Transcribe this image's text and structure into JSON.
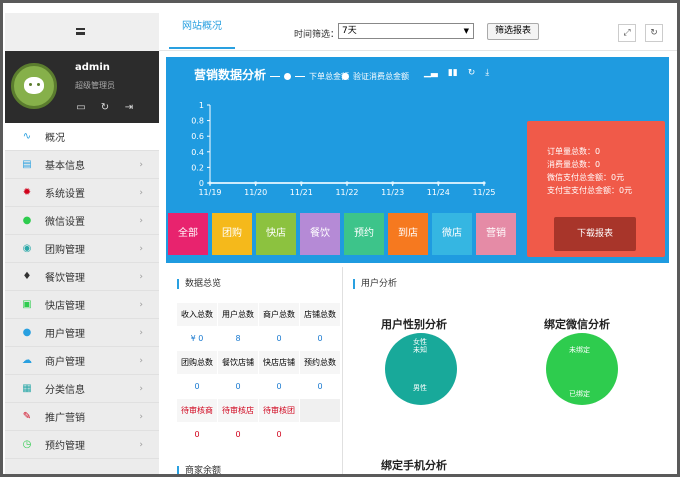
{
  "sidebar": {
    "user": {
      "name": "admin",
      "role": "超级管理员"
    },
    "items": [
      {
        "label": "概况",
        "icon": "line-chart-icon"
      },
      {
        "label": "基本信息",
        "icon": "card-icon"
      },
      {
        "label": "系统设置",
        "icon": "gear-icon"
      },
      {
        "label": "微信设置",
        "icon": "wechat-icon"
      },
      {
        "label": "团购管理",
        "icon": "globe-icon"
      },
      {
        "label": "餐饮管理",
        "icon": "pin-icon"
      },
      {
        "label": "快店管理",
        "icon": "basket-icon"
      },
      {
        "label": "用户管理",
        "icon": "user-icon"
      },
      {
        "label": "商户管理",
        "icon": "cloud-icon"
      },
      {
        "label": "分类信息",
        "icon": "list-icon"
      },
      {
        "label": "推广营销",
        "icon": "pen-icon"
      },
      {
        "label": "预约管理",
        "icon": "clock-icon"
      }
    ]
  },
  "topbar": {
    "tab": "网站概况",
    "filter_label": "时间筛选：",
    "filter_value": "7天",
    "filter_button": "筛选报表"
  },
  "dashboard": {
    "title": "营销数据分析",
    "legend": [
      "下单总金额",
      "验证消费总金额"
    ],
    "stats": [
      "订单量总数：0",
      "消费量总数：0",
      "微信支付总金额：0元",
      "支付宝支付总金额：0元"
    ],
    "download": "下载报表",
    "categories": [
      {
        "label": "全部",
        "color": "#e8236e"
      },
      {
        "label": "团购",
        "color": "#f5b91b"
      },
      {
        "label": "快店",
        "color": "#8cc23f"
      },
      {
        "label": "餐饮",
        "color": "#b58ad6"
      },
      {
        "label": "预约",
        "color": "#3dc48a"
      },
      {
        "label": "到店",
        "color": "#f6791f"
      },
      {
        "label": "微店",
        "color": "#35b6e2"
      },
      {
        "label": "营销",
        "color": "#e58ba6"
      }
    ]
  },
  "chart_data": {
    "type": "line",
    "x": [
      "11/19",
      "11/20",
      "11/21",
      "11/22",
      "11/23",
      "11/24",
      "11/25"
    ],
    "series": [
      {
        "name": "下单总金额",
        "values": [
          0,
          0,
          0,
          0,
          0,
          0,
          0
        ]
      },
      {
        "name": "验证消费总金额",
        "values": [
          0,
          0,
          0,
          0,
          0,
          0,
          0
        ]
      }
    ],
    "yticks": [
      "0",
      "0.2",
      "0.4",
      "0.6",
      "0.8",
      "1"
    ],
    "ylim": [
      0,
      1
    ],
    "grid": false
  },
  "overview": {
    "title": "数据总览",
    "cells": [
      {
        "t": "收入总数",
        "k": "h"
      },
      {
        "t": "用户总数",
        "k": "h"
      },
      {
        "t": "商户总数",
        "k": "h"
      },
      {
        "t": "店铺总数",
        "k": "h"
      },
      {
        "t": "¥ 0",
        "k": "v"
      },
      {
        "t": "8",
        "k": "v"
      },
      {
        "t": "0",
        "k": "v"
      },
      {
        "t": "0",
        "k": "v"
      },
      {
        "t": "团购总数",
        "k": "h"
      },
      {
        "t": "餐饮店铺",
        "k": "h"
      },
      {
        "t": "快店店铺",
        "k": "h"
      },
      {
        "t": "预约总数",
        "k": "h"
      },
      {
        "t": "0",
        "k": "v"
      },
      {
        "t": "0",
        "k": "v"
      },
      {
        "t": "0",
        "k": "v"
      },
      {
        "t": "0",
        "k": "v"
      },
      {
        "t": "待审核商",
        "k": "r"
      },
      {
        "t": "待审核店",
        "k": "r"
      },
      {
        "t": "待审核团",
        "k": "r"
      },
      {
        "t": "",
        "k": "empty"
      },
      {
        "t": "0",
        "k": "rv"
      },
      {
        "t": "0",
        "k": "rv"
      },
      {
        "t": "0",
        "k": "rv"
      },
      {
        "t": "",
        "k": "rv"
      }
    ],
    "next_title": "商家余额"
  },
  "user_analysis": {
    "title": "用户分析",
    "gender_title": "用户性别分析",
    "gender_labels": [
      "女性",
      "未知",
      "男性"
    ],
    "wechat_title": "绑定微信分析",
    "wechat_labels": [
      "未绑定",
      "已绑定"
    ],
    "phone_title": "绑定手机分析"
  }
}
